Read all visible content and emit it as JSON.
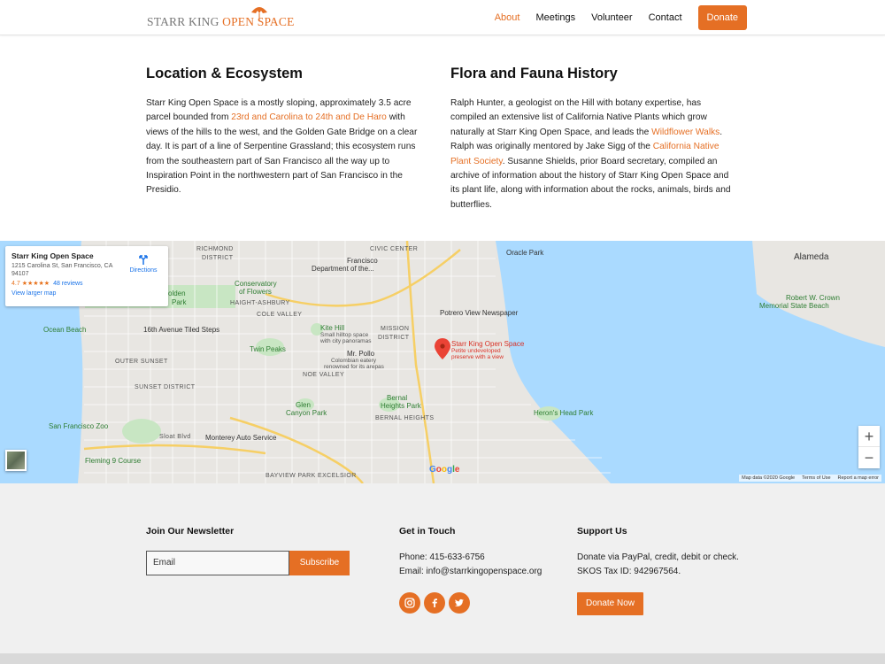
{
  "header": {
    "logo_part1": "STARR KING ",
    "logo_part2": "OPEN SPACE",
    "nav": [
      "About",
      "Meetings",
      "Volunteer",
      "Contact"
    ],
    "donate_label": "Donate"
  },
  "colors": {
    "accent": "#e56f24",
    "link_blue": "#1a73e8",
    "water": "#aadaff",
    "park": "#c8e6c3"
  },
  "location": {
    "title": "Location & Ecosystem",
    "t1": "Starr King Open Space is a mostly sloping, approximately 3.5 acre parcel bounded from ",
    "link1": "23rd and Carolina to 24th and De Haro",
    "t2": " with views of the hills to the west, and the Golden Gate Bridge on a clear day. It is part of a line of Serpentine Grassland; this ecosystem runs from the southeastern part of San Francisco all the way up to Inspiration Point in the northwestern part of San Francisco in the Presidio."
  },
  "flora": {
    "title": "Flora and Fauna History",
    "t1": "Ralph Hunter, a geologist on the Hill with botany expertise, has compiled an extensive list of California Native Plants which grow naturally at Starr King Open Space, and leads the ",
    "link1": "Wildflower Walks",
    "t2": ". Ralph was originally mentored by Jake Sigg of the ",
    "link2": "California Native Plant Society",
    "t3": ". Susanne Shields, prior Board secretary, compiled an archive of information about the history of Starr King Open Space and its plant life, along with information about the rocks, animals, birds and butterflies."
  },
  "map": {
    "card_title": "Starr King Open Space",
    "card_address": "1215 Carolina St, San Francisco, CA 94107",
    "rating": "4.7",
    "stars": "★★★★★",
    "reviews": "48 reviews",
    "larger": "View larger map",
    "directions": "Directions",
    "labels": {
      "richmond": "RICHMOND",
      "district": "DISTRICT",
      "francisco": "Francisco",
      "dept": "Department of the...",
      "civic": "CIVIC CENTER",
      "oracle": "Oracle Park",
      "alameda": "Alameda",
      "conservatory": "Conservatory",
      "of_flowers": "of Flowers",
      "golden": "olden",
      "park": "Park",
      "haight": "HAIGHT-ASHBURY",
      "cole": "COLE VALLEY",
      "potrero": "Potrero View Newspaper",
      "crown": "Robert W. Crown",
      "crown2": "Memorial State Beach",
      "ocean_beach": "Ocean Beach",
      "tiled": "16th Avenue Tiled Steps",
      "kite": "Kite Hill",
      "kite_sub1": "Small hilltop space",
      "kite_sub2": "with city panoramas",
      "mission": "MISSION",
      "mission2": "DISTRICT",
      "twin": "Twin Peaks",
      "mrpollo": "Mr. Pollo",
      "mrpollo_s1": "Colombian eatery",
      "mrpollo_s2": "renowned for its arepas",
      "outer": "OUTER SUNSET",
      "noe": "NOE VALLEY",
      "sunset": "SUNSET DISTRICT",
      "glen": "Glen",
      "glen2": "Canyon Park",
      "bernal": "Bernal",
      "bernal2": "Heights Park",
      "bernal3": "BERNAL HEIGHTS",
      "herons": "Heron's Head Park",
      "sfzoo": "San Francisco Zoo",
      "sloat": "Sloat Blvd",
      "monterey": "Monterey Auto Service",
      "fleming": "Fleming 9 Course",
      "excelsior": "BAYVIEW PARK EXCELSIOR",
      "marker_title": "Starr King Open Space",
      "marker_s1": "Petite undeveloped",
      "marker_s2": "preserve with a view"
    },
    "google": "Google",
    "foot": [
      "Map data ©2020 Google",
      "Terms of Use",
      "Report a map error"
    ],
    "zoom_in": "+",
    "zoom_out": "−"
  },
  "footer": {
    "newsletter_title": "Join Our Newsletter",
    "email_placeholder": "Email",
    "subscribe": "Subscribe",
    "touch_title": "Get in Touch",
    "phone": "Phone: 415-633-6756",
    "email": "Email: info@starrkingopenspace.org",
    "support_title": "Support Us",
    "support1": "Donate via PayPal, credit, debit or check.",
    "support2": "SKOS Tax ID: 942967564.",
    "donate_now": "Donate Now"
  }
}
